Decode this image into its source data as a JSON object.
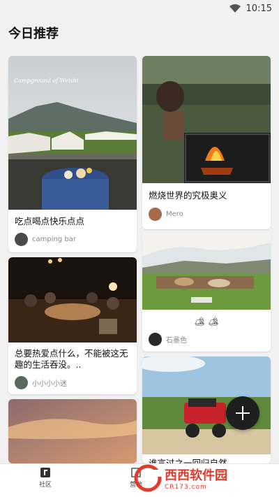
{
  "status_bar": {
    "time": "10:15"
  },
  "page_title": "今日推荐",
  "cards": [
    {
      "title": "吃点喝点快乐点点",
      "author": "camping bar",
      "photo_caption": "Campground of Weishi"
    },
    {
      "title": "燃烧世界的究极奥义",
      "author": "Mero"
    },
    {
      "title": "总要热爱点什么，不能被这无趣的生活吞没。..",
      "author": "小小小小迷"
    },
    {
      "title": "🏕 🏕",
      "author": "石墨色"
    },
    {
      "title": "",
      "author": ""
    },
    {
      "title": "谁言过之一回归自然",
      "author": ""
    }
  ],
  "fab": {
    "icon": "plus-icon"
  },
  "tabs": [
    {
      "label": "社区",
      "icon": "community-icon"
    },
    {
      "label": "营地",
      "icon": "camp-icon"
    }
  ],
  "watermark": {
    "brand": "西西软件园",
    "url": "CR173.com"
  },
  "colors": {
    "background": "#f1f1f1",
    "fab": "#1e1e1e",
    "watermark_red": "#e23b2c"
  }
}
